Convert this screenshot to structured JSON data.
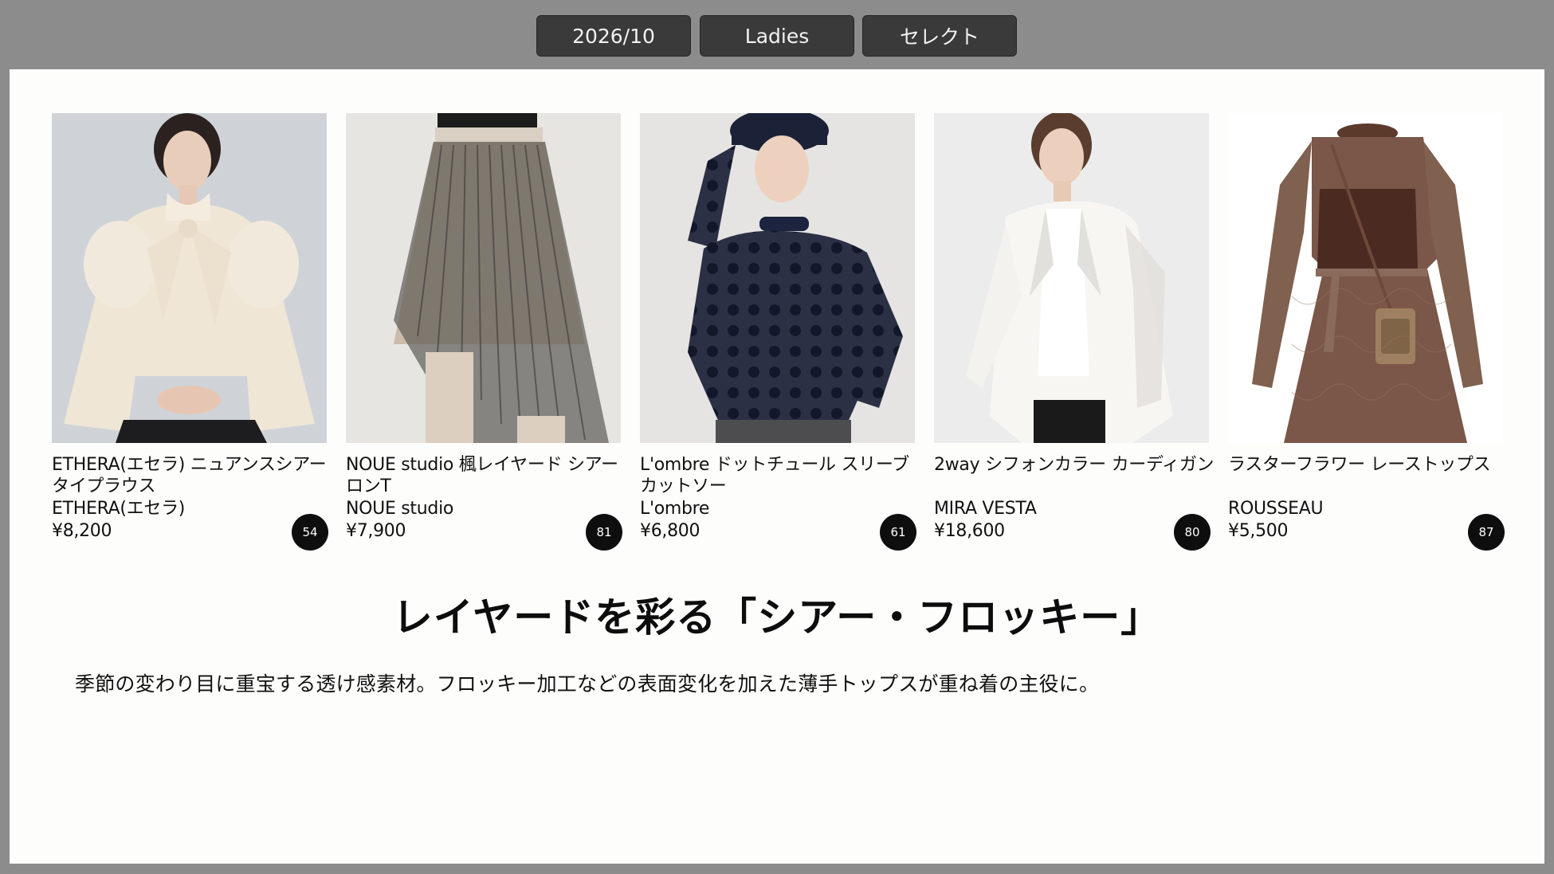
{
  "filters": {
    "date": "2026/10",
    "gender": "Ladies",
    "category": "セレクト"
  },
  "products": [
    {
      "name": "ETHERA(エセラ) ニュアンスシアータイプラウス",
      "brand": "ETHERA(エセラ)",
      "price": "¥8,200",
      "score": "54",
      "image_icon": "blouse-photo-icon"
    },
    {
      "name": "NOUE studio 楓レイヤード シアーロンT",
      "brand": "NOUE studio",
      "price": "¥7,900",
      "score": "81",
      "image_icon": "pleated-skirt-photo-icon"
    },
    {
      "name": "L'ombre ドットチュール スリーブカットソー",
      "brand": "L'ombre",
      "price": "¥6,800",
      "score": "61",
      "image_icon": "dot-tulle-top-photo-icon"
    },
    {
      "name": "2way シフォンカラー カーディガン",
      "brand": "MIRA VESTA",
      "price": "¥18,600",
      "score": "80",
      "image_icon": "white-jacket-photo-icon"
    },
    {
      "name": "ラスターフラワー レーストップス",
      "brand": "ROUSSEAU",
      "price": "¥5,500",
      "score": "87",
      "image_icon": "lace-dress-photo-icon"
    }
  ],
  "feature": {
    "headline": "レイヤードを彩る「シアー・フロッキー」",
    "description": "季節の変わり目に重宝する透け感素材。フロッキー加工などの表面変化を加えた薄手トップスが重ね着の主役に。"
  },
  "colors": {
    "background": "#8c8c8c",
    "button": "#3a3a3a",
    "panel": "#fdfdfc",
    "badge": "#0e0e0e"
  }
}
